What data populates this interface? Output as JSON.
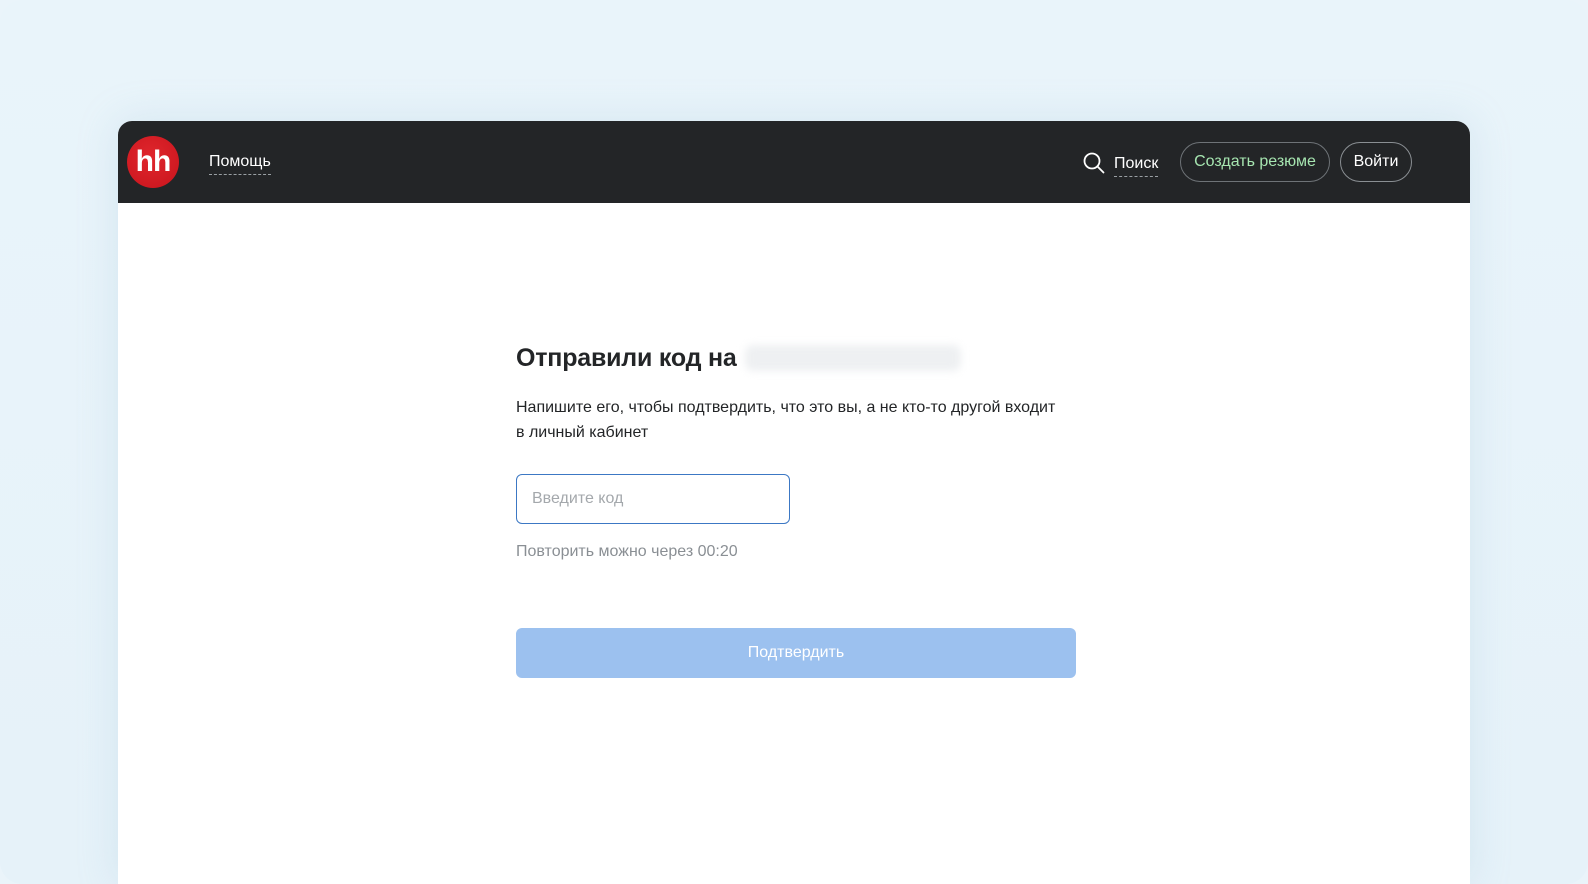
{
  "header": {
    "logo_text": "hh",
    "help_label": "Помощь",
    "search_label": "Поиск",
    "create_resume_label": "Создать резюме",
    "login_label": "Войти"
  },
  "main": {
    "title": "Отправили код на",
    "description": "Напишите его, чтобы подтвердить, что это вы, а не кто-то другой входит в личный кабинет",
    "code_input": {
      "value": "",
      "placeholder": "Введите код"
    },
    "retry_text": "Повторить можно через 00:20",
    "confirm_label": "Подтвердить"
  },
  "colors": {
    "header_bg": "#232527",
    "logo_red": "#d6001c",
    "resume_text": "#a6e5b0",
    "input_border": "#3c78c4",
    "confirm_disabled": "#9cc1ef"
  }
}
